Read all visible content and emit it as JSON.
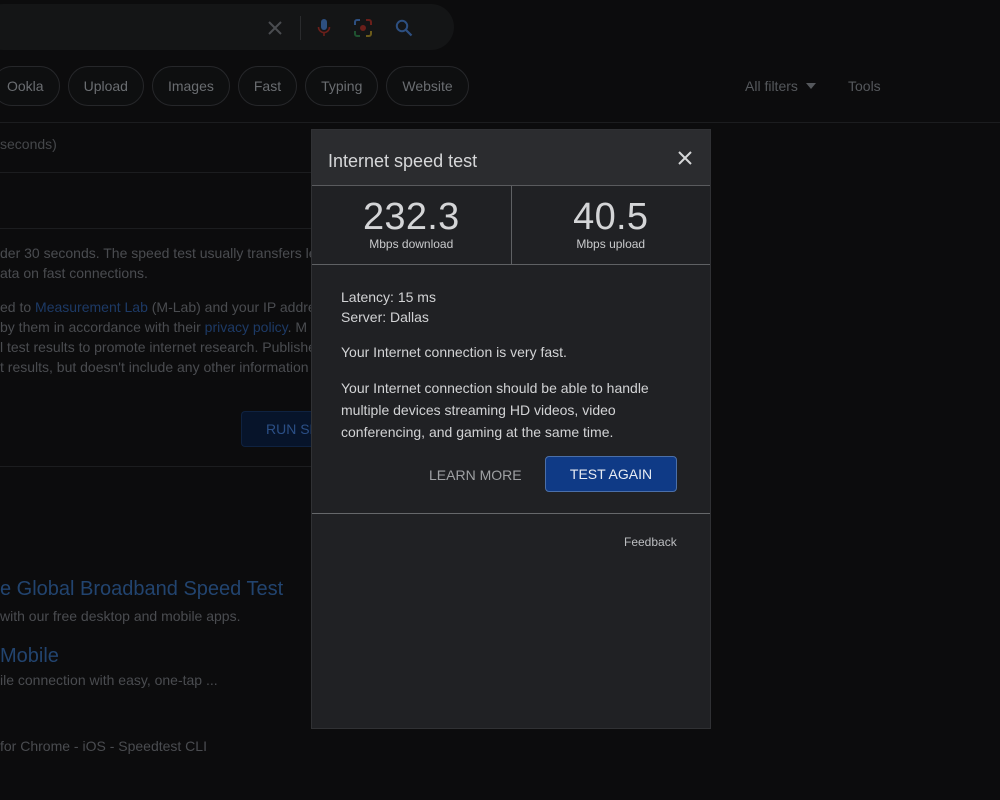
{
  "background": {
    "chips": [
      "Ookla",
      "Upload",
      "Images",
      "Fast",
      "Typing",
      "Website"
    ],
    "all_filters": "All filters",
    "tools": "Tools",
    "result_stats": "seconds)",
    "lines": [
      "der 30 seconds. The speed test usually transfers le",
      "ata on fast connections."
    ],
    "mlab_prefix": "ed to ",
    "mlab_link": "Measurement Lab",
    "mlab_suffix": " (M-Lab) and your IP addre",
    "policy_prefix": " by them in accordance with their ",
    "policy_link": "privacy policy",
    "policy_suffix": ". M",
    "line_research": "l test results to promote internet research. Publishe",
    "line_results": "t results, but doesn't include any other information",
    "run_button": "RUN SPEED TEST",
    "result1_title": "e Global Broadband Speed Test",
    "result1_snippet": " with our free desktop and mobile apps.",
    "result2_title": "Mobile",
    "result2_snippet": "ile connection with easy, one-tap ...",
    "result3_snippet": "for Chrome - iOS - Speedtest CLI"
  },
  "dialog": {
    "title": "Internet speed test",
    "download": {
      "value": "232.3",
      "unit": "Mbps download"
    },
    "upload": {
      "value": "40.5",
      "unit": "Mbps upload"
    },
    "latency": "Latency: 15 ms",
    "server": "Server: Dallas",
    "summary": "Your Internet connection is very fast.",
    "detail": "Your Internet connection should be able to handle multiple devices streaming HD videos, video conferencing, and gaming at the same time.",
    "learn_more": "LEARN MORE",
    "test_again": "TEST AGAIN",
    "feedback": "Feedback"
  },
  "colors": {
    "accent_button": "#0f3a86",
    "dialog_bg": "#202124",
    "header_bg": "#2b2c2f"
  }
}
